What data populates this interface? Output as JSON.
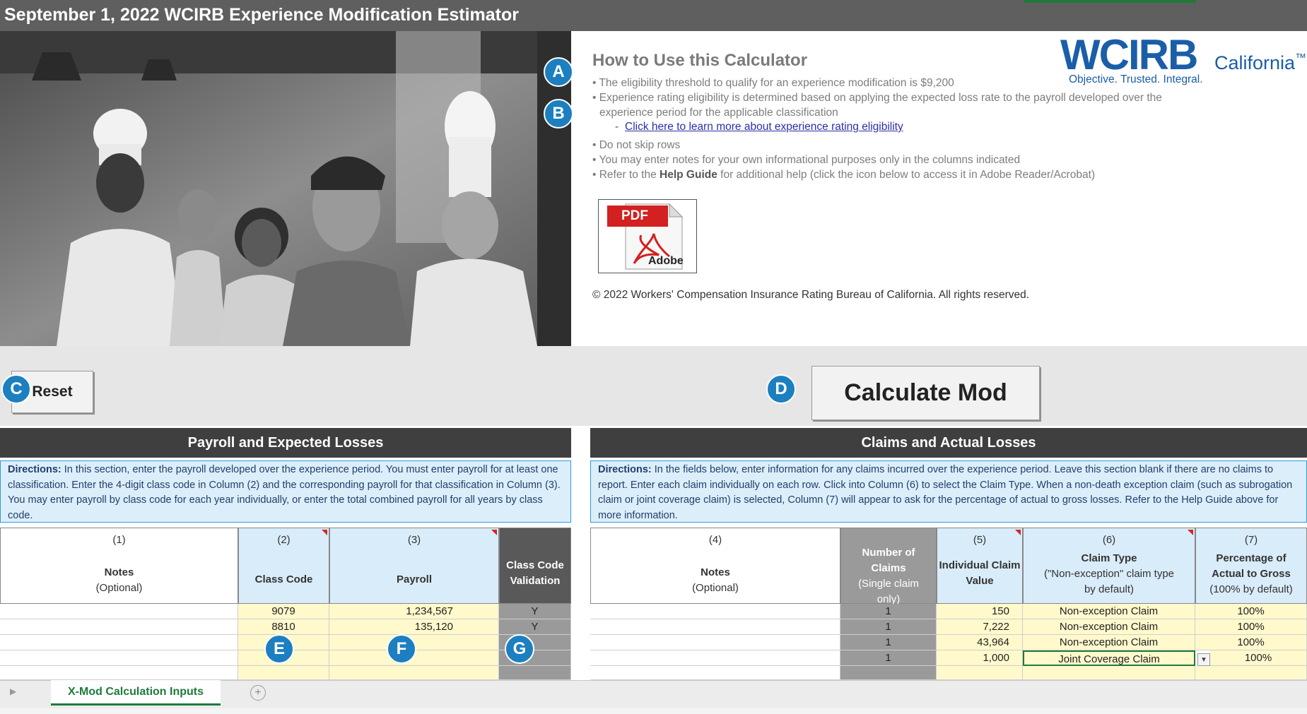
{
  "title": "September 1, 2022 WCIRB Experience Modification Estimator",
  "howto": {
    "heading": "How to Use this Calculator",
    "lines": [
      "• The eligibility threshold to qualify for an experience modification is $9,200",
      "• Experience rating eligibility is determined based on applying the expected loss rate to the payroll developed over the",
      "  experience period for the applicable classification",
      "- Click here to learn more about experience rating eligibility",
      "• Do not skip rows",
      "• You may enter notes for your own informational purposes only in the columns indicated",
      "• Refer to the ",
      "Help Guide",
      " for additional help (click the icon below to access it in Adobe Reader/Acrobat)"
    ],
    "link_dash": "-",
    "link_text": "Click here to learn more about experience rating eligibility"
  },
  "logo": {
    "main": "WCIRB",
    "region": "California",
    "tm": "™",
    "tagline": "Objective. Trusted. Integral."
  },
  "pdf_icon": {
    "label_top": "PDF",
    "label_bottom": "Adobe"
  },
  "copyright": "© 2022 Workers' Compensation Insurance Rating Bureau of California. All rights reserved.",
  "buttons": {
    "reset": "Reset",
    "calculate": "Calculate Mod"
  },
  "badges": [
    "A",
    "B",
    "C",
    "D",
    "E",
    "F",
    "G"
  ],
  "left_section": {
    "heading": "Payroll and Expected Losses",
    "directions_label": "Directions:",
    "directions_text": " In this section, enter the payroll developed over the experience period. You must enter payroll for at least one classification. Enter the 4-digit class code in Column (2) and the corresponding payroll for that classification in Column (3). You may enter payroll by class code for each year individually, or enter the total combined payroll for all years by class code.",
    "columns": [
      {
        "num": "(1)",
        "label": "Notes",
        "sub": "(Optional)"
      },
      {
        "num": "(2)",
        "label": "Class Code"
      },
      {
        "num": "(3)",
        "label": "Payroll"
      },
      {
        "label": "Class Code",
        "label2": "Validation"
      }
    ],
    "rows": [
      {
        "class_code": "9079",
        "payroll": "1,234,567",
        "validation": "Y"
      },
      {
        "class_code": "8810",
        "payroll": "135,120",
        "validation": "Y"
      }
    ]
  },
  "right_section": {
    "heading": "Claims and Actual Losses",
    "directions_label": "Directions:",
    "directions_text": " In the fields below, enter information for any claims incurred over the experience period. Leave this section blank if there are no claims to report. Enter each claim individually on each row. Click into Column (6) to select the Claim Type. When a non-death exception claim (such as subrogation claim or joint coverage claim) is selected, Column (7) will appear to ask for the percentage of actual to gross losses. Refer to the Help Guide above for more information.",
    "columns": [
      {
        "num": "(4)",
        "label": "Notes",
        "sub": "(Optional)"
      },
      {
        "label": "Number of",
        "label2": "Claims",
        "sub": "(Single claim",
        "sub2": "only)"
      },
      {
        "num": "(5)",
        "label": "Individual Claim",
        "label2": "Value"
      },
      {
        "num": "(6)",
        "label": "Claim Type",
        "sub": "(\"Non-exception\" claim type",
        "sub2": "by default)"
      },
      {
        "num": "(7)",
        "label": "Percentage of",
        "label2": "Actual to Gross",
        "sub": "(100% by default)"
      }
    ],
    "rows": [
      {
        "count": "1",
        "value": "150",
        "type": "Non-exception Claim",
        "pct": "100%"
      },
      {
        "count": "1",
        "value": "7,222",
        "type": "Non-exception Claim",
        "pct": "100%"
      },
      {
        "count": "1",
        "value": "43,964",
        "type": "Non-exception Claim",
        "pct": "100%"
      },
      {
        "count": "1",
        "value": "1,000",
        "type": "Joint Coverage Claim",
        "pct": "100%"
      }
    ]
  },
  "sheet_tab": "X-Mod Calculation Inputs",
  "add_sheet": "+",
  "colors": {
    "accent_blue": "#1c7fc0",
    "header_dark": "#3f3f3f",
    "input_yellow": "#fff9cc",
    "excel_green": "#1e7a3c"
  }
}
